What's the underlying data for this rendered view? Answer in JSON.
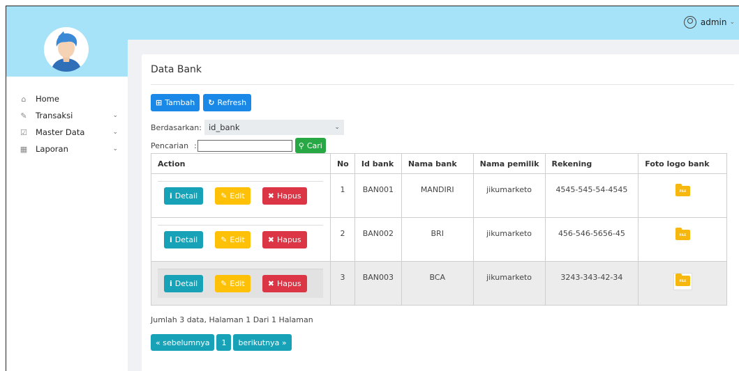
{
  "user": {
    "name": "admin"
  },
  "sidebar": {
    "items": [
      {
        "label": "Home",
        "icon": "home-icon",
        "has_submenu": false
      },
      {
        "label": "Transaksi",
        "icon": "pencil-icon",
        "has_submenu": true
      },
      {
        "label": "Master Data",
        "icon": "edit-icon",
        "has_submenu": true
      },
      {
        "label": "Laporan",
        "icon": "calendar-icon",
        "has_submenu": true
      }
    ]
  },
  "page": {
    "title": "Data Bank"
  },
  "toolbar": {
    "add_label": "Tambah",
    "refresh_label": "Refresh"
  },
  "filter": {
    "by_label": "Berdasarkan:",
    "by_value": "id_bank",
    "search_label": "Pencarian",
    "search_value": "",
    "search_button": "Cari"
  },
  "table": {
    "headers": [
      "Action",
      "No",
      "Id bank",
      "Nama bank",
      "Nama pemilik",
      "Rekening",
      "Foto logo bank"
    ],
    "action_labels": {
      "detail": "Detail",
      "edit": "Edit",
      "delete": "Hapus"
    },
    "file_icon_text": "FILE",
    "rows": [
      {
        "no": "1",
        "id": "BAN001",
        "nama_bank": "MANDIRI",
        "pemilik": "jikumarketo",
        "rekening": "4545-545-54-4545"
      },
      {
        "no": "2",
        "id": "BAN002",
        "nama_bank": "BRI",
        "pemilik": "jikumarketo",
        "rekening": "456-546-5656-45"
      },
      {
        "no": "3",
        "id": "BAN003",
        "nama_bank": "BCA",
        "pemilik": "jikumarketo",
        "rekening": "3243-343-42-34"
      }
    ]
  },
  "summary": "Jumlah 3 data, Halaman 1 Dari 1 Halaman",
  "pagination": {
    "prev": "« sebelumnya",
    "current": "1",
    "next": "berikutnya »"
  },
  "colors": {
    "header_bg": "#a6e3f8",
    "primary": "#1a88e6",
    "success": "#28a745",
    "info": "#17a2b8",
    "warning": "#ffc107",
    "danger": "#dc3545"
  }
}
